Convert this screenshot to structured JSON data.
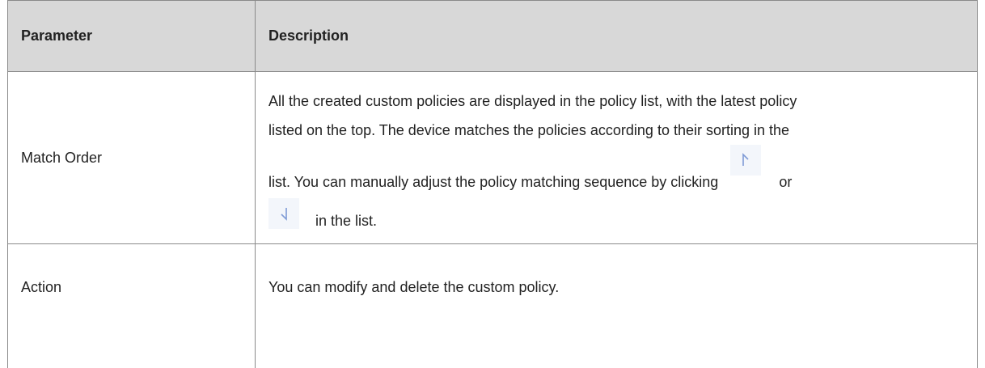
{
  "table": {
    "headers": {
      "parameter": "Parameter",
      "description": "Description"
    },
    "rows": [
      {
        "parameter": "Match Order",
        "description": {
          "line1": "All the created custom policies are displayed in the policy list, with the latest policy",
          "line2": "listed on the top. The device matches the policies according to their sorting in the",
          "line3_before_icon": "list. You can manually adjust the policy matching sequence by clicking",
          "line3_after_icon": "or",
          "line4_after_icon": "in the list."
        },
        "icons": [
          "move-up-arrow-icon",
          "move-down-arrow-icon"
        ]
      },
      {
        "parameter": "Action",
        "description": "You can modify and delete the custom policy."
      }
    ]
  },
  "colors": {
    "header_background": "#d8d8d8",
    "border": "#8a8a8a",
    "icon_background": "#f3f6fb",
    "icon_stroke": "#7f9bd6"
  }
}
